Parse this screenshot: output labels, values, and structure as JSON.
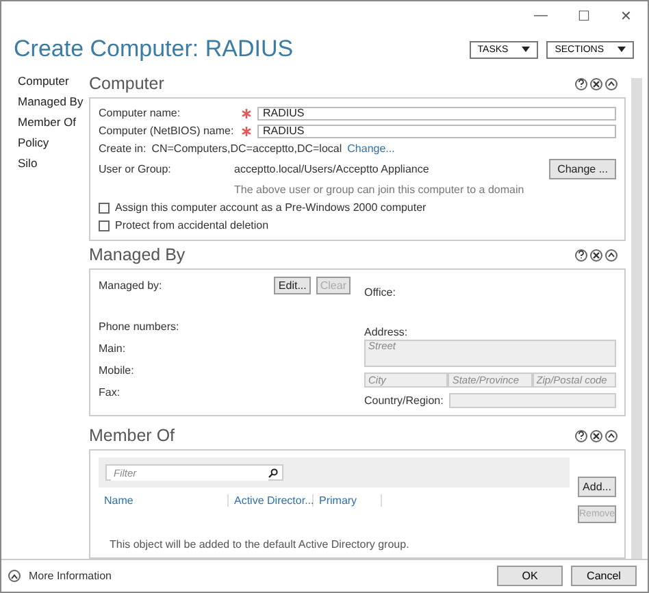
{
  "window": {
    "title": "Create Computer: RADIUS",
    "controls": [
      "—",
      "☐",
      "✕"
    ]
  },
  "header_buttons": [
    {
      "label": "TASKS"
    },
    {
      "label": "SECTIONS"
    }
  ],
  "sidebar": {
    "items": [
      {
        "label": "Computer"
      },
      {
        "label": "Managed By"
      },
      {
        "label": "Member Of"
      },
      {
        "label": "Policy"
      },
      {
        "label": "Silo"
      }
    ]
  },
  "computer": {
    "title": "Computer",
    "name_label": "Computer name:",
    "name_value": "RADIUS",
    "netbios_label": "Computer (NetBIOS) name:",
    "netbios_value": "RADIUS",
    "create_in_label": "Create in:",
    "create_in_value": "CN=Computers,DC=acceptto,DC=local",
    "create_in_link": "Change...",
    "user_label": "User or Group:",
    "user_value": "acceptto.local/Users/Acceptto Appliance",
    "user_button": "Change ...",
    "user_hint": "The above user or group can join this computer to a domain",
    "checkboxes": [
      {
        "label": "Assign this computer account as a Pre-Windows 2000 computer",
        "checked": false
      },
      {
        "label": "Protect from accidental deletion",
        "checked": false
      }
    ]
  },
  "managed_by": {
    "title": "Managed By",
    "managed_label": "Managed by:",
    "edit_button": "Edit...",
    "clear_button": "Clear",
    "office_label": "Office:",
    "phone_label": "Phone numbers:",
    "phones": [
      "Main:",
      "Mobile:",
      "Fax:"
    ],
    "address_label": "Address:",
    "street_placeholder": "Street",
    "city_placeholder": "City",
    "state_placeholder": "State/Province",
    "zip_placeholder": "Zip/Postal code",
    "country_label": "Country/Region:"
  },
  "member_of": {
    "title": "Member Of",
    "filter_placeholder": "Filter",
    "columns": [
      "Name",
      "Active Director...",
      "Primary"
    ],
    "add_button": "Add...",
    "remove_button": "Remove",
    "note": "This object will be added to the default Active Directory group."
  },
  "footer": {
    "more_info": "More Information",
    "buttons": [
      "OK",
      "Cancel"
    ]
  }
}
